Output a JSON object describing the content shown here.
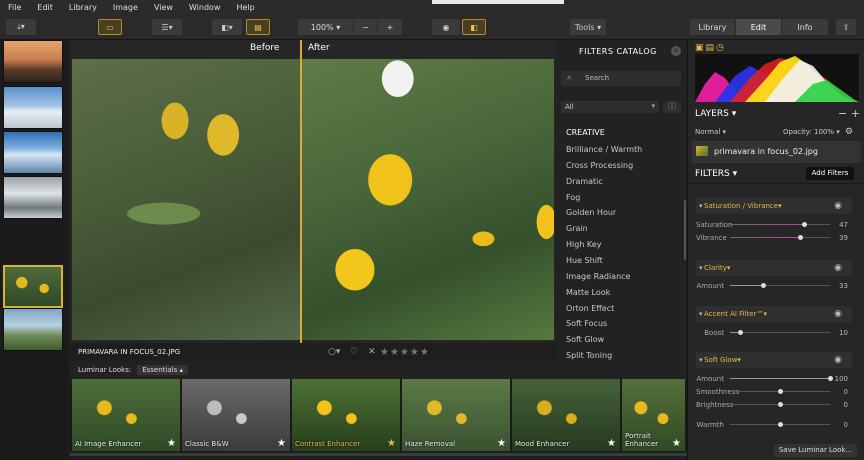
{
  "menu": [
    "File",
    "Edit",
    "Library",
    "Image",
    "View",
    "Window",
    "Help"
  ],
  "toolbar": {
    "zoom": "100%",
    "minus": "−",
    "plus": "+",
    "tools": "Tools",
    "tabs": [
      "Library",
      "Edit",
      "Info"
    ],
    "active_tab": "Edit"
  },
  "viewer": {
    "before_label": "Before",
    "after_label": "After",
    "filename": "PRIMAVARA IN FOCUS_02.JPG",
    "rating_stars": "★★★★★",
    "reject_mark": "✕"
  },
  "looks": {
    "label": "Luminar Looks:",
    "category": "Essentials",
    "items": [
      {
        "name": "AI Image Enhancer"
      },
      {
        "name": "Classic B&W"
      },
      {
        "name": "Contrast Enhancer"
      },
      {
        "name": "Haze Removal"
      },
      {
        "name": "Mood Enhancer"
      },
      {
        "name": "Portrait Enhancer"
      }
    ]
  },
  "catalog": {
    "title": "FILTERS CATALOG",
    "search_placeholder": "Search",
    "filter_select": "All",
    "section": "CREATIVE",
    "items": [
      "Brilliance / Warmth",
      "Cross Processing",
      "Dramatic",
      "Fog",
      "Golden Hour",
      "Grain",
      "High Key",
      "Hue Shift",
      "Image Radiance",
      "Matte Look",
      "Orton Effect",
      "Soft Focus",
      "Soft Glow",
      "Split Toning"
    ]
  },
  "layers": {
    "title": "LAYERS",
    "blend": "Normal",
    "opacity": "Opacity: 100%",
    "layer_name": "primavara in focus_02.jpg"
  },
  "filters": {
    "title": "FILTERS",
    "add_button": "Add Filters",
    "sections": [
      {
        "name": "Saturation / Vibrance",
        "sliders": [
          {
            "label": "Saturation",
            "value": "47",
            "fraction": 0.735
          },
          {
            "label": "Vibrance",
            "value": "39",
            "fraction": 0.695
          }
        ]
      },
      {
        "name": "Clarity",
        "sliders": [
          {
            "label": "Amount",
            "value": "33",
            "fraction": 0.33
          }
        ]
      },
      {
        "name": "Accent AI Filter™",
        "sliders": [
          {
            "label": "Boost",
            "value": "10",
            "fraction": 0.1
          }
        ]
      },
      {
        "name": "Soft Glow",
        "sliders": [
          {
            "label": "Amount",
            "value": "100",
            "fraction": 1.0
          },
          {
            "label": "Smoothness",
            "value": "0",
            "fraction": 0.5
          },
          {
            "label": "Brightness",
            "value": "0",
            "fraction": 0.5
          },
          {
            "label": "Warmth",
            "value": "0",
            "fraction": 0.5
          }
        ]
      }
    ],
    "save_button": "Save Luminar Look..."
  },
  "colors": {
    "accent": "#e8b84a",
    "selected_border": "#d8b436",
    "splitter": "#e0a83a"
  }
}
